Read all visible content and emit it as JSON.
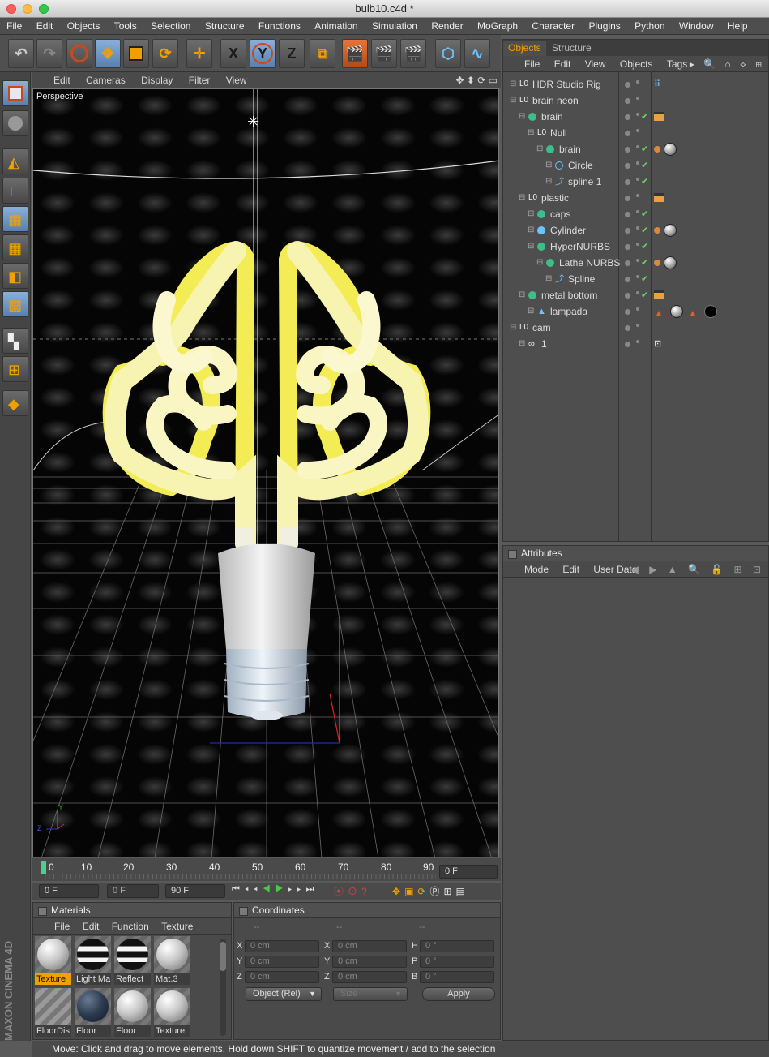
{
  "window": {
    "title": "bulb10.c4d *"
  },
  "menubar": [
    "File",
    "Edit",
    "Objects",
    "Tools",
    "Selection",
    "Structure",
    "Functions",
    "Animation",
    "Simulation",
    "Render",
    "MoGraph",
    "Character",
    "Plugins",
    "Python",
    "Window",
    "Help"
  ],
  "toolbar": {
    "axis_x": "X",
    "axis_y": "Y",
    "axis_z": "Z"
  },
  "viewport": {
    "menu": [
      "Edit",
      "Cameras",
      "Display",
      "Filter",
      "View"
    ],
    "label": "Perspective",
    "axis_y": "Y",
    "axis_z": "Z"
  },
  "timeline": {
    "ticks": [
      "0",
      "10",
      "20",
      "30",
      "40",
      "50",
      "60",
      "70",
      "80",
      "90"
    ],
    "current_frame": "0 F",
    "start_frame": "0 F",
    "preview_min": "0 F",
    "end_frame": "90 F"
  },
  "materials": {
    "title": "Materials",
    "menu": [
      "File",
      "Edit",
      "Function",
      "Texture"
    ],
    "items": [
      {
        "name": "Texture",
        "style": "white",
        "active": true
      },
      {
        "name": "Light Ma",
        "style": "band"
      },
      {
        "name": "Reflect",
        "style": "band"
      },
      {
        "name": "Mat.3",
        "style": "white"
      },
      {
        "name": "FloorDis",
        "style": "stripe"
      },
      {
        "name": "Floor",
        "style": "navy"
      },
      {
        "name": "Floor",
        "style": "white"
      },
      {
        "name": "Texture",
        "style": "white"
      }
    ]
  },
  "coordinates": {
    "title": "Coordinates",
    "col_headers": [
      "--",
      "--",
      "--"
    ],
    "rows": [
      {
        "l1": "X",
        "v1": "0 cm",
        "l2": "X",
        "v2": "0 cm",
        "l3": "H",
        "v3": "0 °"
      },
      {
        "l1": "Y",
        "v1": "0 cm",
        "l2": "Y",
        "v2": "0 cm",
        "l3": "P",
        "v3": "0 °"
      },
      {
        "l1": "Z",
        "v1": "0 cm",
        "l2": "Z",
        "v2": "0 cm",
        "l3": "B",
        "v3": "0 °"
      }
    ],
    "mode": "Object (Rel)",
    "size_mode": "Size",
    "apply": "Apply"
  },
  "status": "Move: Click and drag to move elements. Hold down SHIFT to quantize movement / add to the selection",
  "brand": "MAXON CINEMA 4D",
  "objects_panel": {
    "tabs": [
      "Objects",
      "Structure"
    ],
    "menu": [
      "File",
      "Edit",
      "View",
      "Objects",
      "Tags"
    ],
    "tree": [
      {
        "name": "HDR Studio Rig",
        "depth": 0,
        "icon": "null",
        "check": false,
        "tags": [
          "dots"
        ]
      },
      {
        "name": "brain neon",
        "depth": 0,
        "icon": "null",
        "check": false,
        "tags": []
      },
      {
        "name": "brain",
        "depth": 1,
        "icon": "symmetry",
        "check": true,
        "tags": [
          "clapper"
        ]
      },
      {
        "name": "Null",
        "depth": 2,
        "icon": "null",
        "check": false,
        "tags": []
      },
      {
        "name": "brain",
        "depth": 3,
        "icon": "sweep",
        "check": true,
        "tags": [
          "phong",
          "sphere"
        ]
      },
      {
        "name": "Circle",
        "depth": 4,
        "icon": "circle",
        "check": true,
        "tags": []
      },
      {
        "name": "spline 1",
        "depth": 4,
        "icon": "spline",
        "check": true,
        "tags": []
      },
      {
        "name": "plastic",
        "depth": 1,
        "icon": "null",
        "check": false,
        "tags": [
          "clapper"
        ]
      },
      {
        "name": "caps",
        "depth": 2,
        "icon": "symmetry",
        "check": true,
        "tags": []
      },
      {
        "name": "Cylinder",
        "depth": 2,
        "icon": "cylinder",
        "check": true,
        "tags": [
          "phong",
          "sphere"
        ]
      },
      {
        "name": "HyperNURBS",
        "depth": 2,
        "icon": "hypernurbs",
        "check": true,
        "tags": []
      },
      {
        "name": "Lathe NURBS",
        "depth": 3,
        "icon": "lathe",
        "check": true,
        "tags": [
          "phong",
          "sphere"
        ]
      },
      {
        "name": "Spline",
        "depth": 4,
        "icon": "spline",
        "check": true,
        "tags": []
      },
      {
        "name": "metal bottom",
        "depth": 1,
        "icon": "hypernurbs",
        "check": true,
        "tags": [
          "clapper"
        ]
      },
      {
        "name": "lampada",
        "depth": 2,
        "icon": "polygon",
        "check": false,
        "tags": [
          "cone",
          "sphere",
          "cone",
          "black"
        ]
      },
      {
        "name": "cam",
        "depth": 0,
        "icon": "null",
        "check": false,
        "tags": []
      },
      {
        "name": "1",
        "depth": 1,
        "icon": "camera",
        "check": false,
        "tags": [
          "target"
        ]
      }
    ]
  },
  "attributes_panel": {
    "title": "Attributes",
    "menu": [
      "Mode",
      "Edit",
      "User Data"
    ]
  },
  "colors": {
    "accent_orange": "#f0a000",
    "check_green": "#6ad46a",
    "bulb_yellow": "#f5ef8a"
  }
}
